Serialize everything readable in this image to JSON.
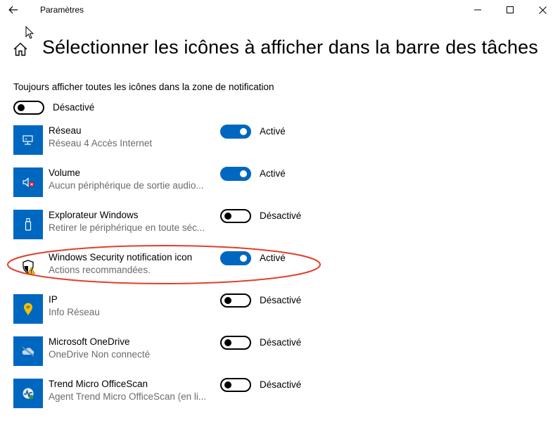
{
  "window": {
    "title": "Paramètres",
    "back_icon": "arrow-left-icon",
    "minimize_icon": "minimize-icon",
    "maximize_icon": "maximize-icon",
    "close_icon": "close-icon"
  },
  "page": {
    "home_icon": "home-icon",
    "title": "Sélectionner les icônes à afficher dans la barre des tâches"
  },
  "always_show": {
    "label": "Toujours afficher toutes les icônes dans la zone de notification",
    "state": "Désactivé",
    "on": false
  },
  "items": [
    {
      "name": "Réseau",
      "desc": "Réseau 4 Accès Internet",
      "state": "Activé",
      "on": true,
      "icon": "network-icon"
    },
    {
      "name": "Volume",
      "desc": "Aucun périphérique de sortie audio...",
      "state": "Activé",
      "on": true,
      "icon": "volume-muted-icon"
    },
    {
      "name": "Explorateur Windows",
      "desc": "Retirer le périphérique en toute séc...",
      "state": "Désactivé",
      "on": false,
      "icon": "usb-icon"
    },
    {
      "name": "Windows Security notification icon",
      "desc": "Actions recommandées.",
      "state": "Activé",
      "on": true,
      "icon": "shield-warning-icon"
    },
    {
      "name": "IP",
      "desc": "Info Réseau",
      "state": "Désactivé",
      "on": false,
      "icon": "ip-pin-icon"
    },
    {
      "name": "Microsoft OneDrive",
      "desc": "OneDrive Non connecté",
      "state": "Désactivé",
      "on": false,
      "icon": "onedrive-icon"
    },
    {
      "name": "Trend Micro OfficeScan",
      "desc": "Agent Trend Micro OfficeScan (en li...",
      "state": "Désactivé",
      "on": false,
      "icon": "trend-micro-icon"
    }
  ],
  "colors": {
    "accent": "#0067c0",
    "annotation": "#e0402a"
  }
}
